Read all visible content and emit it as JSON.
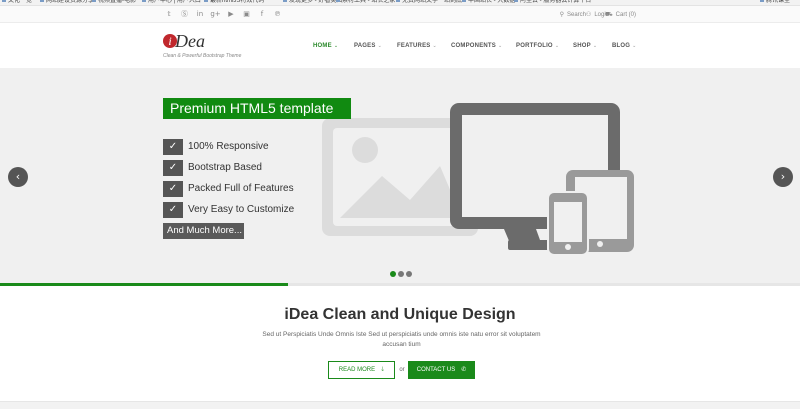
{
  "browser": {
    "bookmarks": [
      "文化一览",
      "网站建设资源分享",
      "视频直播-电影",
      "用户中心 | 用户入口",
      "最新htmlJS特效代码",
      "发现更多 - 好看美图",
      "素材工具 - 站长之家",
      "免费网站文字一站到底",
      "中国站长 - 大数据",
      "阿里云 - 服务器云计算平台",
      "腾讯课堂"
    ]
  },
  "topbar": {
    "social_icons": [
      "twitter-icon",
      "skype-icon",
      "linkedin-icon",
      "google-plus-icon",
      "youtube-icon",
      "flickr-icon",
      "facebook-icon",
      "pinterest-icon"
    ],
    "social_glyphs": [
      "𝕥",
      "Ⓢ",
      "in",
      "g+",
      "▶",
      "▣",
      "f",
      "℗"
    ],
    "search_label": "Search",
    "login_label": "Login",
    "cart_label": "Cart (0)"
  },
  "header": {
    "logo_letter": "i",
    "logo_word": "Dea",
    "tagline": "Clean & Powerful Bootstrap Theme",
    "nav": [
      "HOME",
      "PAGES",
      "FEATURES",
      "COMPONENTS",
      "PORTFOLIO",
      "SHOP",
      "BLOG"
    ],
    "active_index": 0,
    "caret": "⌄"
  },
  "slider": {
    "title": "Premium HTML5 template",
    "features": [
      "100% Responsive",
      "Bootstrap Based",
      "Packed Full of Features",
      "Very Easy to Customize"
    ],
    "check_glyph": "✓",
    "more_button": "And Much More...",
    "prev_glyph": "‹",
    "next_glyph": "›",
    "slide_count": 3,
    "current_slide": 1,
    "progress": 0.36,
    "colors": {
      "accent": "#118a11",
      "device": "#6b6b6b",
      "placeholder": "#dddddd"
    }
  },
  "intro": {
    "title": "iDea Clean and Unique Design",
    "text": "Sed ut Perspiciatis Unde Omnis Iste Sed ut perspiciatis unde omnis iste natu error sit voluptatem accusan tium",
    "read_more": "READ MORE",
    "read_more_icon": "🡓",
    "or": "or",
    "contact": "CONTACT US",
    "contact_icon": "✆"
  }
}
